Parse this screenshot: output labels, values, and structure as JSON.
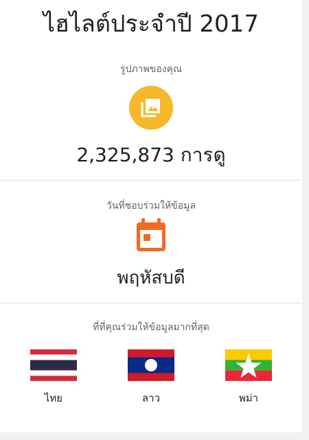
{
  "header": {
    "title": "ไฮไลต์ประจำปี 2017"
  },
  "photos": {
    "label": "รูปภาพของคุณ",
    "icon": "photo-library-icon",
    "stat": "2,325,873 การดู",
    "accent": "#F6B82B"
  },
  "day": {
    "label": "วันที่ชอบร่วมให้ข้อมูล",
    "icon": "calendar-icon",
    "value": "พฤหัสบดี",
    "accent": "#EF6C23"
  },
  "countries": {
    "label": "ที่ที่คุณร่วมให้ข้อมูลมากที่สุด",
    "items": [
      {
        "name": "ไทย",
        "flag": "thailand-flag"
      },
      {
        "name": "ลาว",
        "flag": "laos-flag"
      },
      {
        "name": "พม่า",
        "flag": "myanmar-flag"
      }
    ]
  }
}
